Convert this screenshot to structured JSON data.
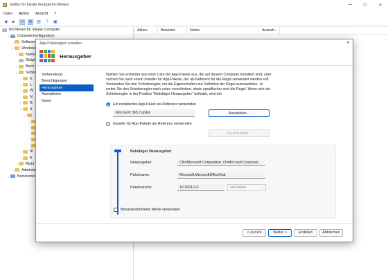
{
  "window": {
    "title": "Editor für lokale Gruppenrichtlinien"
  },
  "menu": [
    "Datei",
    "Aktion",
    "Ansicht",
    "?"
  ],
  "tree": {
    "root": "Richtlinien für lokaler Computer",
    "items": [
      {
        "label": "Computerkonfiguration",
        "indent": 1,
        "tw": "⌄",
        "icon": "blue"
      },
      {
        "label": "Software",
        "indent": 2,
        "tw": "›",
        "icon": "folder"
      },
      {
        "label": "Windows",
        "indent": 2,
        "tw": "⌄",
        "icon": "folder"
      },
      {
        "label": "Name",
        "indent": 3,
        "tw": "›",
        "icon": "folder"
      },
      {
        "label": "Skript",
        "indent": 3,
        "tw": "",
        "icon": "gray"
      },
      {
        "label": "Berei",
        "indent": 3,
        "tw": "›",
        "icon": "folder"
      },
      {
        "label": "Sicher",
        "indent": 3,
        "tw": "⌄",
        "icon": "folder"
      },
      {
        "label": "K",
        "indent": 4,
        "tw": "›",
        "icon": "folder"
      },
      {
        "label": "L",
        "indent": 4,
        "tw": "›",
        "icon": "folder"
      },
      {
        "label": "W",
        "indent": 4,
        "tw": "›",
        "icon": "folder"
      },
      {
        "label": "N",
        "indent": 4,
        "tw": "",
        "icon": "folder"
      },
      {
        "label": "R",
        "indent": 4,
        "tw": "›",
        "icon": "folder"
      },
      {
        "label": "A",
        "indent": 4,
        "tw": "⌄",
        "icon": "folder"
      },
      {
        "label": "",
        "indent": 5,
        "tw": "⌄",
        "icon": "folder"
      },
      {
        "label": "",
        "indent": 6,
        "tw": "",
        "icon": "folder"
      },
      {
        "label": "",
        "indent": 6,
        "tw": "",
        "icon": "folder"
      },
      {
        "label": "",
        "indent": 6,
        "tw": "",
        "icon": "folder"
      },
      {
        "label": "",
        "indent": 6,
        "tw": "",
        "icon": "folder"
      },
      {
        "label": "",
        "indent": 6,
        "tw": "",
        "icon": "folder"
      },
      {
        "label": "IP",
        "indent": 4,
        "tw": "›",
        "icon": "folder"
      },
      {
        "label": "E",
        "indent": 4,
        "tw": "›",
        "icon": "folder"
      },
      {
        "label": "Richt",
        "indent": 3,
        "tw": "›",
        "icon": "folder"
      },
      {
        "label": "Administ",
        "indent": 2,
        "tw": "›",
        "icon": "folder"
      },
      {
        "label": "Benutzerkon",
        "indent": 1,
        "tw": "›",
        "icon": "blue"
      }
    ]
  },
  "list": {
    "columns": [
      "Aktion",
      "Benutzer",
      "Name",
      "Ausnah..."
    ]
  },
  "dialog": {
    "title": "App-Paketregeln erstellen",
    "heading": "Herausgeber",
    "steps": [
      "Vorbereitung",
      "Berechtigungen",
      "Herausgeber",
      "Ausnahmen",
      "Name"
    ],
    "active_step": 2,
    "description": "Wählen Sie entweder aus einer Liste der App-Pakete aus, die auf diesem Computer installiert sind, oder suchen Sie nach einem Installer für App-Pakete, der als Referenz für die Regel verwendet werden soll. Verwenden Sie den Schieberegler, um die Eigenschaften zur Definition der Regel auszuwählen. Je weiter Sie den Schieberegler nach unten verschieben, desto spezifischer wird die Regel. Wenn sich der Schieberegler in der Position \"Beliebiger Herausgeber\" befindet, wird der",
    "radio_installed": "Ein installiertes App-Paket als Referenz verwenden",
    "selected_package": "Microsoft 365 Copilot",
    "select_button": "Auswählen...",
    "radio_installer": "Installer für App-Pakete als Referenz verwenden",
    "browse_button": "Durchsuchen...",
    "publisher_panel": {
      "title": "Beliebiger Herausgeber",
      "publisher_label": "Herausgeber:",
      "publisher_value": "CN=Microsoft Corporation, O=Microsoft Corporati",
      "package_label": "Paketname:",
      "package_value": "Microsoft.MicrosoftOfficeHub",
      "version_label": "Paketversion:",
      "version_value": "19.2601.0.0",
      "version_op": "und höher",
      "slider_level": 1.0
    },
    "custom_values_label": "Benutzerdefinierte Werte verwenden",
    "buttons": {
      "back": "< Zurück",
      "next": "Weiter >",
      "create": "Erstellen",
      "cancel": "Abbrechen"
    }
  }
}
